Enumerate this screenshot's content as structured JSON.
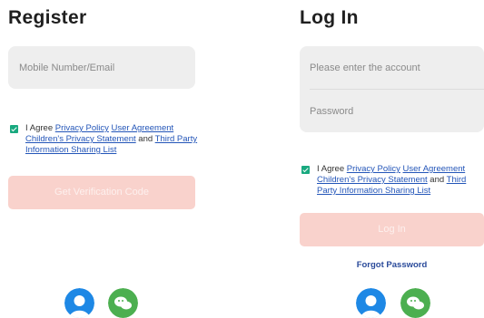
{
  "register": {
    "title": "Register",
    "mobile_placeholder": "Mobile Number/Email",
    "agree_prefix": "I Agree ",
    "privacy_policy": "Privacy Policy",
    "user_agreement": "User Agreement",
    "children_privacy": "Children's Privacy Statement",
    "and_text": " and ",
    "third_party": "Third Party Information Sharing List",
    "submit_label": "Get Verification Code"
  },
  "login": {
    "title": "Log In",
    "account_placeholder": "Please enter the account",
    "password_placeholder": "Password",
    "agree_prefix": "I Agree ",
    "privacy_policy": "Privacy Policy",
    "user_agreement": "User Agreement",
    "children_privacy": "Children's Privacy Statement",
    "and_text": " and ",
    "third_party": "Third Party Information Sharing List",
    "submit_label": "Log In",
    "forgot_label": "Forgot Password"
  },
  "social": [
    {
      "icon": "user-avatar-icon",
      "color": "#1e88e5"
    },
    {
      "icon": "wechat-icon",
      "color": "#4caf50"
    }
  ],
  "colors": {
    "accent_disabled": "#f9d2cc",
    "checkbox": "#19a97f",
    "link": "#2355b8"
  }
}
